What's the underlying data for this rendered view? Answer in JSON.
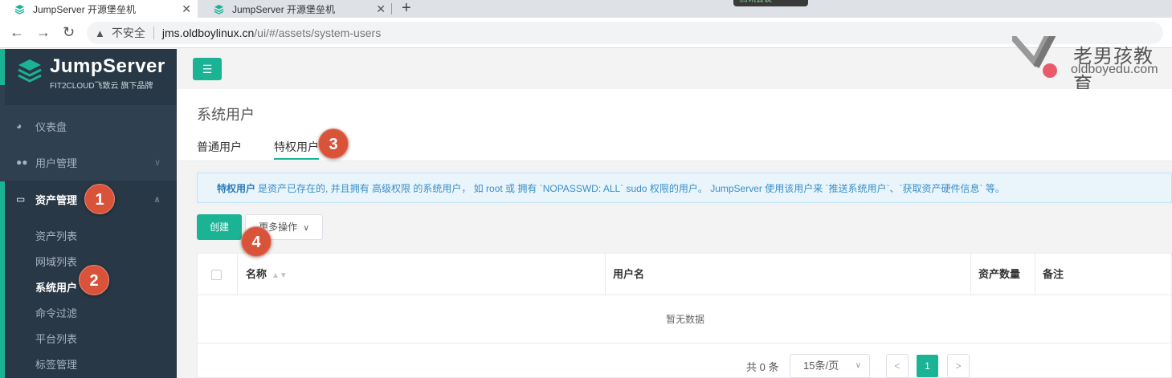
{
  "browser": {
    "tabs": [
      {
        "title": "JumpServer 开源堡垒机",
        "active": true
      },
      {
        "title": "JumpServer 开源堡垒机",
        "active": false
      }
    ],
    "new_tab": "+",
    "close_glyph": "✕",
    "meeting_text": "腾讯会议",
    "security_label": "不安全",
    "url_host": "jms.oldboylinux.cn",
    "url_path": "/ui/#/assets/system-users"
  },
  "sidebar": {
    "logo_title": "JumpServer",
    "logo_sub": "FIT2CLOUD飞致云 旗下品牌",
    "menu": [
      {
        "label": "仪表盘",
        "icon": "dashboard-icon"
      },
      {
        "label": "用户管理",
        "icon": "users-icon"
      },
      {
        "label": "资产管理",
        "icon": "inbox-icon"
      }
    ],
    "submenu": [
      "资产列表",
      "网域列表",
      "系统用户",
      "命令过滤",
      "平台列表",
      "标签管理"
    ],
    "active_sub": "系统用户"
  },
  "branding": {
    "cn": "老男孩教育",
    "en": "oldboyedu.com"
  },
  "page": {
    "title": "系统用户",
    "tabs": [
      "普通用户",
      "特权用户"
    ],
    "active_tab": "特权用户"
  },
  "info": {
    "bold": "特权用户",
    "text": "是资产已存在的, 并且拥有 高级权限 的系统用户， 如 root 或 拥有 `NOPASSWD: ALL` sudo 权限的用户。 JumpServer 使用该用户来 `推送系统用户`、`获取资产硬件信息` 等。"
  },
  "actions": {
    "create": "创建",
    "more": "更多操作"
  },
  "table": {
    "columns": [
      "名称",
      "用户名",
      "资产数量",
      "备注"
    ],
    "empty": "暂无数据"
  },
  "pagination": {
    "total": "共 0 条",
    "page_size": "15条/页",
    "prev": "<",
    "next": ">",
    "current": "1"
  },
  "markers": [
    "1",
    "2",
    "3",
    "4"
  ],
  "colors": {
    "primary": "#1ab394",
    "sidebar": "#2f4050",
    "marker": "#d9533b",
    "info_text": "#3a8ec9"
  }
}
